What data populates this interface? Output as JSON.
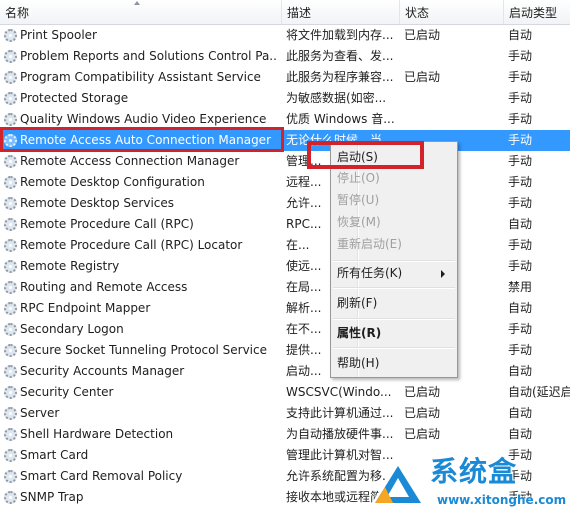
{
  "columns": {
    "name": "名称",
    "description": "描述",
    "status": "状态",
    "startup_type": "启动类型"
  },
  "services": [
    {
      "name": "Print Spooler",
      "description": "将文件加载到内存...",
      "status": "已启动",
      "startup": "自动"
    },
    {
      "name": "Problem Reports and Solutions Control Pa...",
      "description": "此服务为查看、发...",
      "status": "",
      "startup": "手动"
    },
    {
      "name": "Program Compatibility Assistant Service",
      "description": "此服务为程序兼容...",
      "status": "已启动",
      "startup": "手动"
    },
    {
      "name": "Protected Storage",
      "description": "为敏感数据(如密...",
      "status": "",
      "startup": "手动"
    },
    {
      "name": "Quality Windows Audio Video Experience",
      "description": "优质 Windows 音...",
      "status": "",
      "startup": "手动"
    },
    {
      "name": "Remote Access Auto Connection Manager",
      "description": "无论什么时候，当...",
      "status": "",
      "startup": "手动"
    },
    {
      "name": "Remote Access Connection Manager",
      "description": "管理...",
      "status": "",
      "startup": "手动"
    },
    {
      "name": "Remote Desktop Configuration",
      "description": "远程...",
      "status": "",
      "startup": "手动"
    },
    {
      "name": "Remote Desktop Services",
      "description": "允许...",
      "status": "",
      "startup": "手动"
    },
    {
      "name": "Remote Procedure Call (RPC)",
      "description": "RPC...",
      "status": "",
      "startup": "自动"
    },
    {
      "name": "Remote Procedure Call (RPC) Locator",
      "description": "在...",
      "status": "",
      "startup": "手动"
    },
    {
      "name": "Remote Registry",
      "description": "使远...",
      "status": "",
      "startup": "手动"
    },
    {
      "name": "Routing and Remote Access",
      "description": "在局...",
      "status": "",
      "startup": "禁用"
    },
    {
      "name": "RPC Endpoint Mapper",
      "description": "解析...",
      "status": "",
      "startup": "自动"
    },
    {
      "name": "Secondary Logon",
      "description": "在不...",
      "status": "",
      "startup": "手动"
    },
    {
      "name": "Secure Socket Tunneling Protocol Service",
      "description": "提供...",
      "status": "",
      "startup": "手动"
    },
    {
      "name": "Security Accounts Manager",
      "description": "启动...",
      "status": "",
      "startup": "自动"
    },
    {
      "name": "Security Center",
      "description": "WSCSVC(Windo...",
      "status": "已启动",
      "startup": "自动(延迟启"
    },
    {
      "name": "Server",
      "description": "支持此计算机通过...",
      "status": "已启动",
      "startup": "自动"
    },
    {
      "name": "Shell Hardware Detection",
      "description": "为自动播放硬件事...",
      "status": "已启动",
      "startup": "自动"
    },
    {
      "name": "Smart Card",
      "description": "管理此计算机对智...",
      "status": "",
      "startup": "手动"
    },
    {
      "name": "Smart Card Removal Policy",
      "description": "允许系统配置为移...",
      "status": "",
      "startup": "手动"
    },
    {
      "name": "SNMP Trap",
      "description": "接收本地或远程简...",
      "status": "",
      "startup": "手动"
    }
  ],
  "context_menu": {
    "start": "启动(S)",
    "stop": "停止(O)",
    "pause": "暂停(U)",
    "resume": "恢复(M)",
    "restart": "重新启动(E)",
    "all_tasks": "所有任务(K)",
    "refresh": "刷新(F)",
    "properties": "属性(R)",
    "help": "帮助(H)"
  },
  "watermark": {
    "brand": "系统盒",
    "url": "www.xitonghe.com"
  },
  "colors": {
    "selection": "#3399ff",
    "annotation": "#d3222a",
    "watermark": "#1a8ad6"
  }
}
